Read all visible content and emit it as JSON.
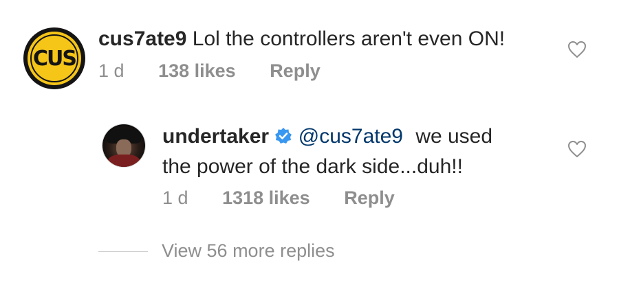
{
  "comment": {
    "avatar_text": "CUS",
    "username": "cus7ate9",
    "text": "Lol the controllers aren't even ON!",
    "time": "1 d",
    "likes": "138 likes",
    "reply_label": "Reply"
  },
  "reply": {
    "username": "undertaker",
    "mention": "@cus7ate9",
    "text_line1": "we used",
    "text_line2": "the power of the dark side...duh!!",
    "time": "1 d",
    "likes": "1318 likes",
    "reply_label": "Reply",
    "verified_color": "#3897f0"
  },
  "view_more_label": "View 56 more replies",
  "icons": {
    "like": "heart-outline-icon",
    "verified": "verified-badge-icon"
  }
}
